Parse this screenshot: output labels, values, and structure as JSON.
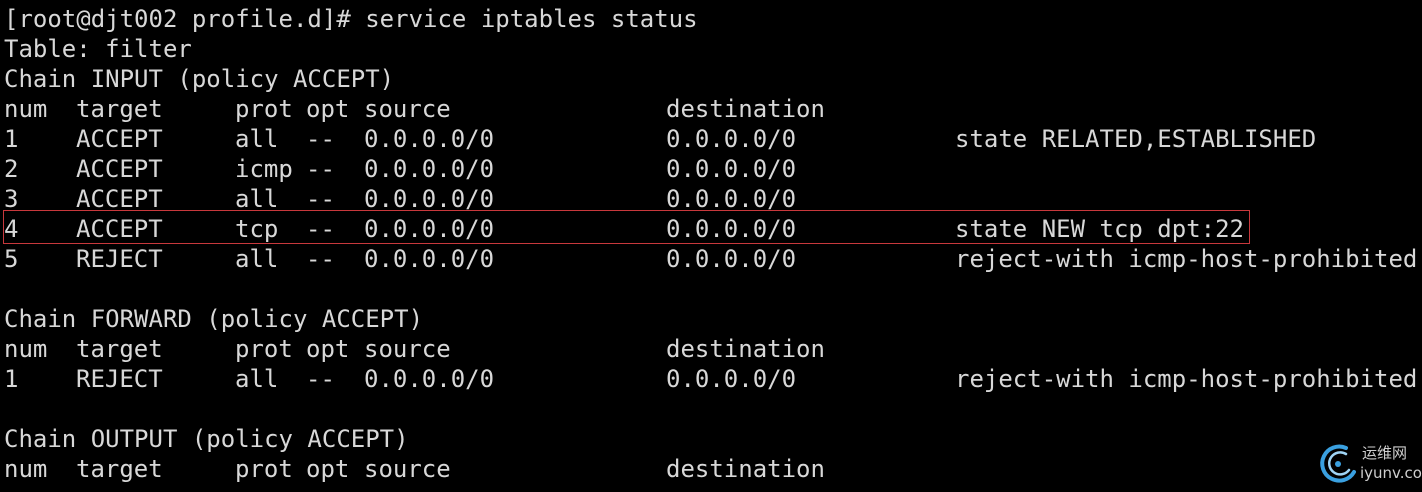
{
  "terminal": {
    "prompt_line": "[root@djt002 profile.d]# service iptables status",
    "table_line": "Table: filter",
    "header": {
      "num": "num",
      "target": "target",
      "prot": "prot",
      "opt": "opt",
      "source": "source",
      "destination": "destination"
    },
    "input_chain": {
      "title": "Chain INPUT (policy ACCEPT)",
      "rows": [
        {
          "num": "1",
          "target": "ACCEPT",
          "prot": "all",
          "opt": "--",
          "source": "0.0.0.0/0",
          "destination": "0.0.0.0/0",
          "extra": "state RELATED,ESTABLISHED"
        },
        {
          "num": "2",
          "target": "ACCEPT",
          "prot": "icmp",
          "opt": "--",
          "source": "0.0.0.0/0",
          "destination": "0.0.0.0/0",
          "extra": ""
        },
        {
          "num": "3",
          "target": "ACCEPT",
          "prot": "all",
          "opt": "--",
          "source": "0.0.0.0/0",
          "destination": "0.0.0.0/0",
          "extra": ""
        },
        {
          "num": "4",
          "target": "ACCEPT",
          "prot": "tcp",
          "opt": "--",
          "source": "0.0.0.0/0",
          "destination": "0.0.0.0/0",
          "extra": "state NEW tcp dpt:22"
        },
        {
          "num": "5",
          "target": "REJECT",
          "prot": "all",
          "opt": "--",
          "source": "0.0.0.0/0",
          "destination": "0.0.0.0/0",
          "extra": "reject-with icmp-host-prohibited"
        }
      ]
    },
    "forward_chain": {
      "title": "Chain FORWARD (policy ACCEPT)",
      "rows": [
        {
          "num": "1",
          "target": "REJECT",
          "prot": "all",
          "opt": "--",
          "source": "0.0.0.0/0",
          "destination": "0.0.0.0/0",
          "extra": "reject-with icmp-host-prohibited"
        }
      ]
    },
    "output_chain": {
      "title": "Chain OUTPUT (policy ACCEPT)"
    }
  },
  "watermark": {
    "cn": "运维网",
    "en": "iyunv.com"
  },
  "colors": {
    "background": "#000000",
    "text": "#d8d8d8",
    "highlight_border": "#c8383c"
  }
}
